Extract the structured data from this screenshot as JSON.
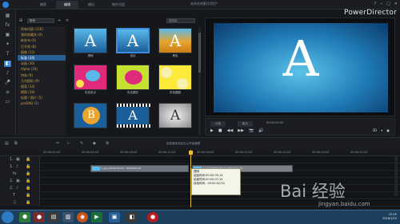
{
  "app": {
    "title": "未命名的影片项目*",
    "brand": "PowerDirector",
    "window_controls": [
      "?",
      "─",
      "□",
      "✕"
    ]
  },
  "header_tabs": [
    {
      "label": "捕获"
    },
    {
      "label": "编辑"
    },
    {
      "label": "输出"
    },
    {
      "label": "制作光盘"
    }
  ],
  "library": {
    "filter": "所有",
    "search_placeholder": "搜索库",
    "categories": [
      "所有内容 (116)",
      "我的收藏夹 (0)",
      "新发布 (0)",
      "打开帧 (8)",
      "图像 (12)",
      "标准 (34)",
      "动画 (30)",
      "Alpha (19)",
      "特效 (9)",
      "几何图形 (9)",
      "图案 (14)",
      "模版 (18)",
      "标题 / 图片 (5)",
      "proDAD (1)"
    ],
    "thumbs": [
      {
        "label": "透明"
      },
      {
        "label": "波纹"
      },
      {
        "label": "黑色"
      },
      {
        "label": "彩色斑点"
      },
      {
        "label": "彩色圆形"
      },
      {
        "label": "彩色圆圈"
      },
      {
        "label": "B"
      },
      {
        "label": "A"
      },
      {
        "label": "A"
      }
    ]
  },
  "preview": {
    "letter": "A",
    "modes": {
      "clip": "片段",
      "movie": "影片"
    },
    "timecode": "00:00:00:00",
    "controls": [
      "▶",
      "■",
      "◀◀",
      "▶▶",
      "📷",
      "🔊"
    ],
    "right_controls": [
      "3D",
      "▾",
      "▣"
    ]
  },
  "timeline": {
    "hint": "拖放媒体到此处以开始编辑",
    "ruler": [
      "00:00:00;00",
      "00:00:04;00",
      "00:00:08;00",
      "00:00:12;00",
      "00:00:16;00",
      "00:00:20;00",
      "00:00:24;00",
      "00:00:28;00",
      "00:00:32;00"
    ],
    "tracks": [
      {
        "label": "1.",
        "icon": "▣"
      },
      {
        "label": "1.",
        "icon": "♪"
      },
      {
        "label": "fx",
        "icon": "fx"
      },
      {
        "label": "2.",
        "icon": "▣"
      },
      {
        "label": "2.",
        "icon": "♪"
      },
      {
        "label": "T",
        "icon": "T"
      },
      {
        "label": "♫",
        "icon": "♫"
      }
    ],
    "clips": [
      {
        "text": "1.jpg | 00:00:00:00 - 00:00:05:00"
      },
      {
        "text": "1.jpg | 00:00:06:14 - 00:00:11:14"
      }
    ],
    "tooltip": {
      "title": "透明",
      "start": "起始时间:00:00:05;14",
      "end": "结束时间:00:00:07;14",
      "duration": "持续时间：00:00:02;00"
    }
  },
  "taskbar": {
    "time": "22:05",
    "date": "2018/1/10"
  },
  "watermark": {
    "big": "Bai 经验",
    "small": "jingyan.baidu.com"
  }
}
